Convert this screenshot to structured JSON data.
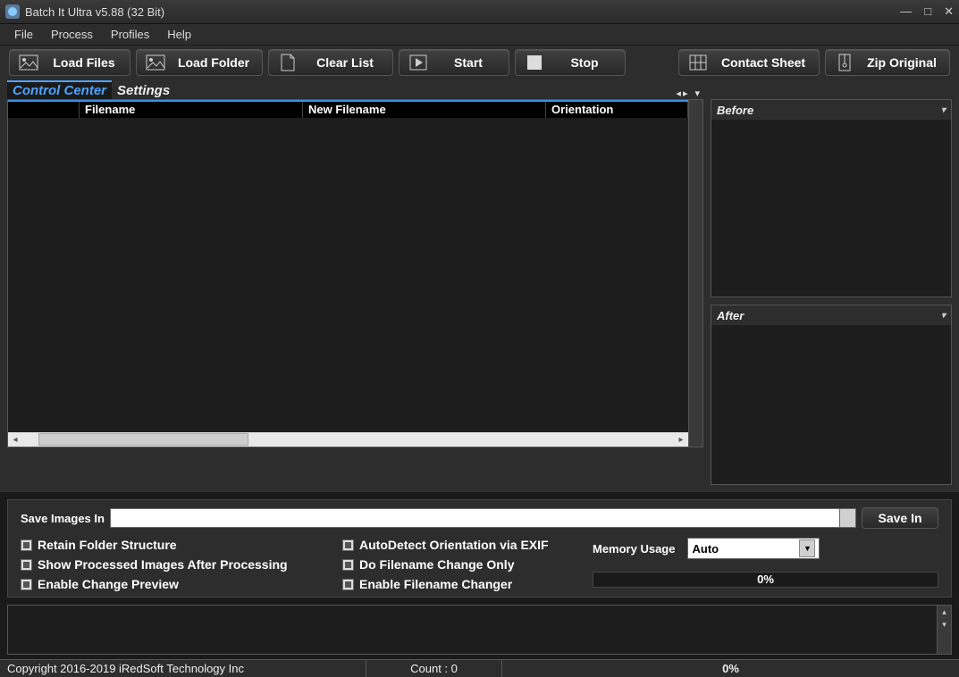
{
  "window": {
    "title": "Batch It Ultra v5.88 (32 Bit)"
  },
  "menu": {
    "file": "File",
    "process": "Process",
    "profiles": "Profiles",
    "help": "Help"
  },
  "toolbar": {
    "load_files": "Load Files",
    "load_folder": "Load Folder",
    "clear_list": "Clear List",
    "start": "Start",
    "stop": "Stop",
    "contact_sheet": "Contact Sheet",
    "zip_original": "Zip Original"
  },
  "tabs": {
    "control_center": "Control Center",
    "settings": "Settings"
  },
  "grid": {
    "columns": {
      "filename": "Filename",
      "new_filename": "New Filename",
      "orientation": "Orientation"
    }
  },
  "preview": {
    "before": "Before",
    "after": "After"
  },
  "options": {
    "save_images_in_label": "Save Images In",
    "save_path": "",
    "save_in_btn": "Save In",
    "retain_folder": "Retain Folder Structure",
    "show_processed": "Show Processed Images After Processing",
    "enable_change_preview": "Enable Change Preview",
    "autodetect_orientation": "AutoDetect Orientation via EXIF",
    "do_filename_change_only": "Do Filename Change Only",
    "enable_filename_changer": "Enable Filename Changer",
    "memory_usage_label": "Memory Usage",
    "memory_usage_value": "Auto",
    "mem_pct": "0%"
  },
  "status": {
    "copyright": "Copyright 2016-2019 iRedSoft Technology Inc",
    "count": "Count : 0",
    "progress": "0%"
  }
}
